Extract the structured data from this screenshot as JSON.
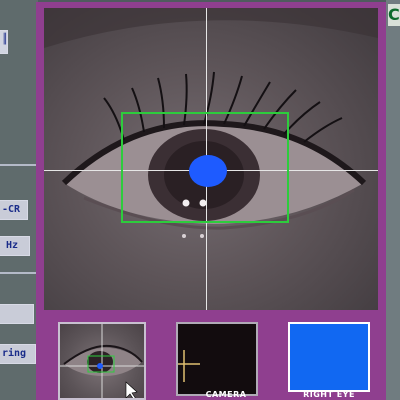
{
  "left_panel": {
    "widgets": [
      {
        "text": "║"
      },
      {
        "text": "-CR"
      },
      {
        "text": "Hz"
      },
      {
        "text": ""
      },
      {
        "text": "ring"
      }
    ]
  },
  "right_panel": {
    "header_letter": "C"
  },
  "camera_view": {
    "pupil_marker_color": "#1e5bff",
    "tracking_box_color": "#2dcc3c",
    "crosshair_color": "#e6e6e6"
  },
  "thumbnails": {
    "camera_label": "CAMERA",
    "right_eye_label": "RIGHT EYE",
    "right_eye_color": "#1168f2"
  }
}
